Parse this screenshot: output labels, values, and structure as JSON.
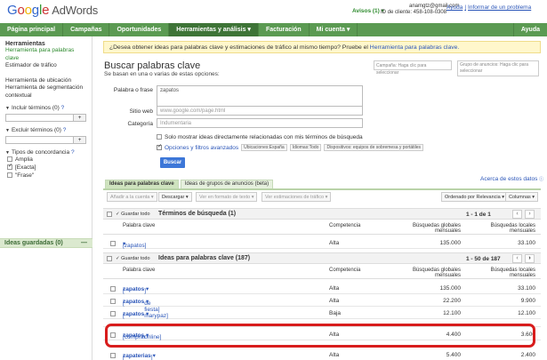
{
  "header": {
    "logo_google": "Google",
    "logo_adwords": "AdWords",
    "alerts": "Avisos (1)",
    "account_email": "anamgtz@gmail.com",
    "customer_id": "ID de cliente: 458-108-0308",
    "help_link": "Ayuda",
    "report_link": "Informar de un problema",
    "separator": "|"
  },
  "nav": {
    "items": [
      "Página principal",
      "Campañas",
      "Oportunidades",
      "Herramientas y análisis ▾",
      "Facturación",
      "Mi cuenta ▾"
    ],
    "right": "Ayuda"
  },
  "sidebar": {
    "section": "Herramientas",
    "links": [
      "Herramienta para palabras clave",
      "Estimador de tráfico"
    ],
    "links2": [
      "Herramienta de ubicación",
      "Herramienta de segmentación contextual"
    ],
    "include_label": "Incluir términos (0)",
    "exclude_label": "Excluir términos (0)",
    "match_label": "Tipos de concordancia",
    "match_types": [
      "Amplia",
      "[Exacta]",
      "\"Frase\""
    ],
    "input_btn": "+",
    "saved_label": "Ideas guardadas (0)",
    "saved_toggle": "—"
  },
  "main": {
    "notice_text": "¿Desea obtener ideas para palabras clave y estimaciones de tráfico al mismo tiempo? Pruebe el",
    "notice_link": "Herramienta para palabras clave.",
    "title": "Buscar palabras clave",
    "subtitle": "Se basan en una o varias de estas opciones:",
    "campaign_placeholder": "Campaña: Haga clic para seleccionar",
    "adgroup_placeholder": "Grupo de anuncios: Haga clic para seleccionar",
    "form": {
      "word_label": "Palabra o frase",
      "word_value": "zapatos",
      "web_label": "Sitio web",
      "web_placeholder": "www.google.com/page.html",
      "category_label": "Categoría",
      "category_placeholder": "Indumentaria"
    },
    "only_show": "Solo mostrar ideas directamente relacionadas con mis términos de búsqueda",
    "advanced": "Opciones y filtros avanzados",
    "chips": [
      "Ubicaciones:España",
      "Idiomas:Todo",
      "Dispositivos: equipos de sobremesa y portátiles"
    ],
    "search_button": "Buscar",
    "tabs": [
      "Ideas para palabras clave",
      "Ideas de grupos de anuncios (beta)"
    ],
    "about_link": "Acerca de estos datos",
    "toolbar": {
      "add": "Añadir a la cuenta",
      "download": "Descargar",
      "see_as": "Ver en formato de texto",
      "see_traffic": "Ver estimaciones de tráfico",
      "sort": "Ordenado por Relevancia",
      "columns": "Columnas"
    }
  },
  "search_terms": {
    "guard_label": "✓ Guardar todo",
    "title": "Términos de búsqueda (1)",
    "pagination": "1 - 1 de 1",
    "columns": [
      "Palabra clave",
      "Competencia",
      "Búsquedas globales mensuales",
      "Búsquedas locales mensuales"
    ],
    "rows": [
      {
        "kw": "[zapatos]",
        "comp": "Alta",
        "glob": "135.000",
        "loc": "33.100"
      }
    ]
  },
  "ideas": {
    "guard_label": "✓ Guardar todo",
    "title": "Ideas para palabras clave (187)",
    "pagination": "1 - 50 de 187",
    "columns": [
      "Palabra clave",
      "Competencia",
      "Búsquedas globales mensuales",
      "Búsquedas locales mensuales"
    ],
    "rows": [
      {
        "kw_pre": "[",
        "kw_bold": "zapatos",
        "kw_post": "]",
        "comp": "Alta",
        "glob": "135.000",
        "loc": "33.100"
      },
      {
        "kw_pre": "[",
        "kw_bold": "zapatos",
        "kw_post": " de fiesta]",
        "comp": "Alta",
        "glob": "22.200",
        "loc": "9.900"
      },
      {
        "kw_pre": "[",
        "kw_bold": "zapatos",
        "kw_post": " marypaz]",
        "comp": "Baja",
        "glob": "12.100",
        "loc": "12.100"
      },
      {
        "kw_pre": "[comprar ",
        "kw_bold": "zapatos",
        "kw_post": " online]",
        "comp": "Alta",
        "glob": "4.400",
        "loc": "3.600"
      },
      {
        "kw_pre": "[",
        "kw_bold": "zapaterias",
        "kw_post": "]",
        "comp": "Alta",
        "glob": "5.400",
        "loc": "2.400"
      }
    ]
  }
}
